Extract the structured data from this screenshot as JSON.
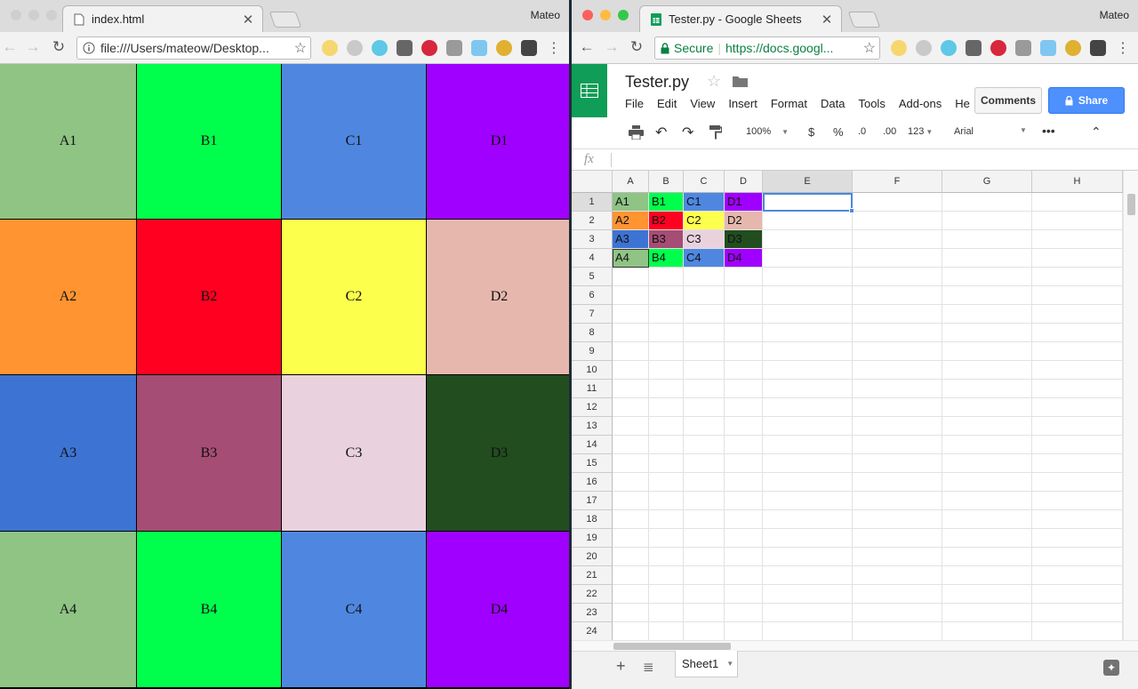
{
  "left_window": {
    "tab_title": "index.html",
    "user_name": "Mateo",
    "url": "file:///Users/mateow/Desktop...",
    "grid": [
      [
        {
          "label": "A1",
          "color": "#8fc485"
        },
        {
          "label": "B1",
          "color": "#00ff4c"
        },
        {
          "label": "C1",
          "color": "#4f87e0"
        },
        {
          "label": "D1",
          "color": "#a000ff"
        }
      ],
      [
        {
          "label": "A2",
          "color": "#ff9431"
        },
        {
          "label": "B2",
          "color": "#ff0021"
        },
        {
          "label": "C2",
          "color": "#fdff4d"
        },
        {
          "label": "D2",
          "color": "#e6b8ad"
        }
      ],
      [
        {
          "label": "A3",
          "color": "#3d74d3"
        },
        {
          "label": "B3",
          "color": "#a54d75"
        },
        {
          "label": "C3",
          "color": "#e9d2de"
        },
        {
          "label": "D3",
          "color": "#214d1f"
        }
      ],
      [
        {
          "label": "A4",
          "color": "#8fc485"
        },
        {
          "label": "B4",
          "color": "#00ff4c"
        },
        {
          "label": "C4",
          "color": "#4f87e0"
        },
        {
          "label": "D4",
          "color": "#a000ff"
        }
      ]
    ]
  },
  "right_window": {
    "tab_title": "Tester.py - Google Sheets",
    "user_name": "Mateo",
    "secure_label": "Secure",
    "url": "https://docs.googl...",
    "doc_title": "Tester.py",
    "menu": [
      "File",
      "Edit",
      "View",
      "Insert",
      "Format",
      "Data",
      "Tools",
      "Add-ons",
      "He"
    ],
    "comments_label": "Comments",
    "share_label": "Share",
    "toolbar": {
      "zoom": "100%",
      "currency": "$",
      "percent": "%",
      "dec_less": ".0",
      "dec_more": ".00",
      "number_format": "123",
      "font": "Arial"
    },
    "fx_label": "fx",
    "columns": [
      "A",
      "B",
      "C",
      "D",
      "E",
      "F",
      "G",
      "H"
    ],
    "row_numbers": [
      "1",
      "2",
      "3",
      "4",
      "5",
      "6",
      "7",
      "8",
      "9",
      "10",
      "11",
      "12",
      "13",
      "14",
      "15",
      "16",
      "17",
      "18",
      "19",
      "20",
      "21",
      "22",
      "23",
      "24"
    ],
    "cells": [
      [
        {
          "label": "A1",
          "color": "#8fc485"
        },
        {
          "label": "B1",
          "color": "#00ff4c"
        },
        {
          "label": "C1",
          "color": "#4f87e0"
        },
        {
          "label": "D1",
          "color": "#a000ff"
        }
      ],
      [
        {
          "label": "A2",
          "color": "#ff9431"
        },
        {
          "label": "B2",
          "color": "#ff0021"
        },
        {
          "label": "C2",
          "color": "#fdff4d"
        },
        {
          "label": "D2",
          "color": "#e6b8ad"
        }
      ],
      [
        {
          "label": "A3",
          "color": "#3d74d3"
        },
        {
          "label": "B3",
          "color": "#a54d75"
        },
        {
          "label": "C3",
          "color": "#e9d2de"
        },
        {
          "label": "D3",
          "color": "#214d1f"
        }
      ],
      [
        {
          "label": "A4",
          "color": "#8fc485"
        },
        {
          "label": "B4",
          "color": "#00ff4c"
        },
        {
          "label": "C4",
          "color": "#4f87e0"
        },
        {
          "label": "D4",
          "color": "#a000ff"
        }
      ]
    ],
    "selected_cell": "E1",
    "sheet_tab": "Sheet1"
  }
}
